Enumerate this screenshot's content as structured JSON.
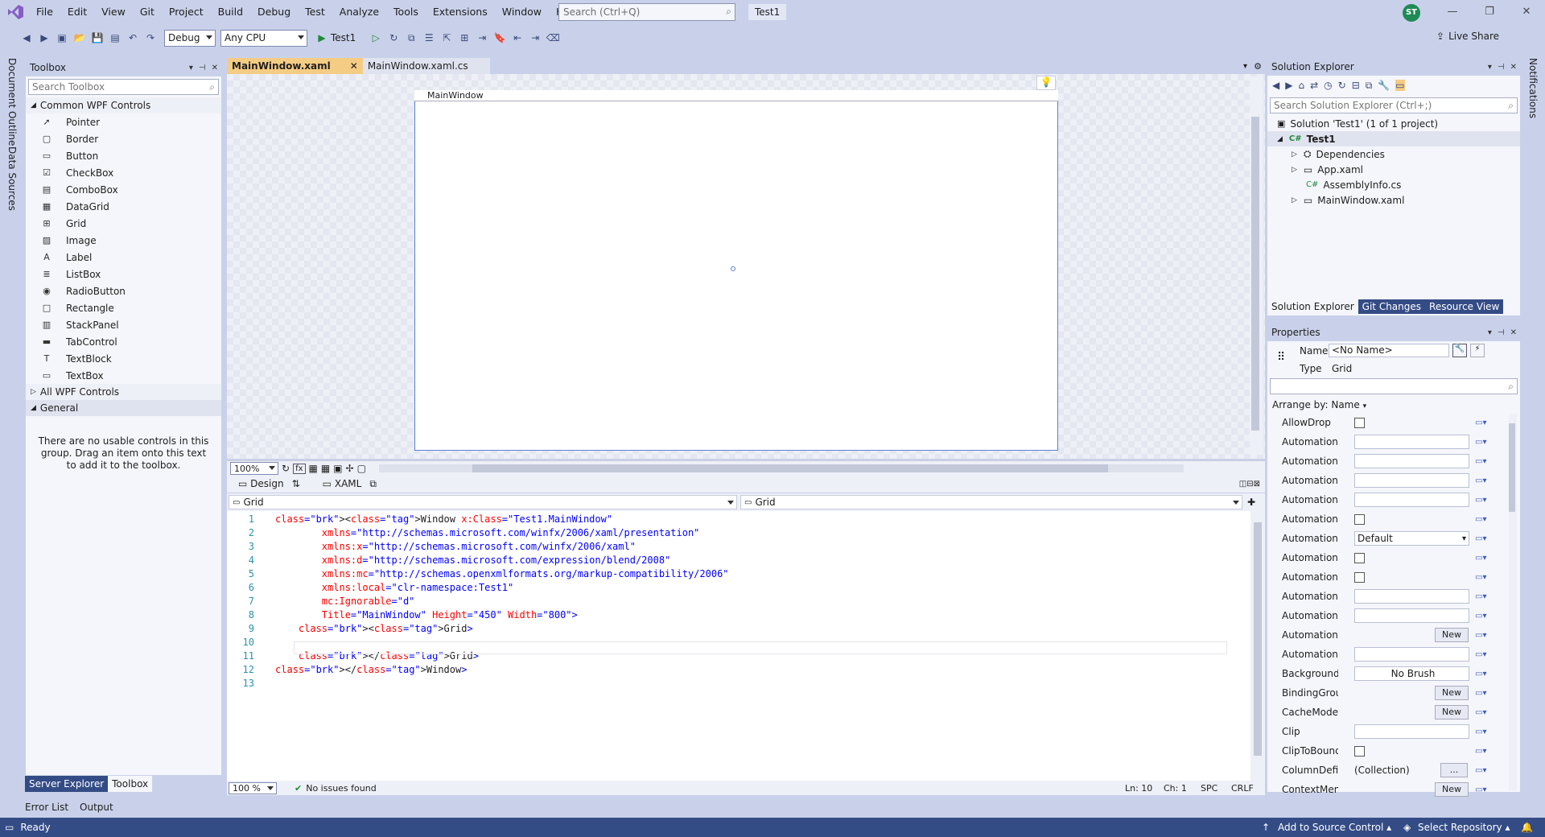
{
  "menu": [
    "File",
    "Edit",
    "View",
    "Git",
    "Project",
    "Build",
    "Debug",
    "Test",
    "Analyze",
    "Tools",
    "Extensions",
    "Window",
    "Help"
  ],
  "search": {
    "placeholder": "Search (Ctrl+Q)"
  },
  "solution_name": "Test1",
  "avatar_initials": "ST",
  "toolbar": {
    "config": "Debug",
    "platform": "Any CPU",
    "start": "Test1",
    "live_share": "Live Share"
  },
  "left_strip": [
    "Document Outline",
    "Data Sources"
  ],
  "right_strip": [
    "Notifications"
  ],
  "toolbox": {
    "title": "Toolbox",
    "search_placeholder": "Search Toolbox",
    "group_common": "Common WPF Controls",
    "items": [
      "Pointer",
      "Border",
      "Button",
      "CheckBox",
      "ComboBox",
      "DataGrid",
      "Grid",
      "Image",
      "Label",
      "ListBox",
      "RadioButton",
      "Rectangle",
      "StackPanel",
      "TabControl",
      "TextBlock",
      "TextBox"
    ],
    "group_all": "All WPF Controls",
    "group_general": "General",
    "empty_text": "There are no usable controls in this group. Drag an item onto this text to add it to the toolbox.",
    "tabs": [
      "Server Explorer",
      "Toolbox"
    ]
  },
  "doc_tabs": [
    "MainWindow.xaml",
    "MainWindow.xaml.cs"
  ],
  "designer": {
    "window_title": "MainWindow",
    "zoom": "100%",
    "design_tab": "Design",
    "xaml_tab": "XAML"
  },
  "xaml_nav": {
    "left": "Grid",
    "right": "Grid"
  },
  "code": [
    {
      "n": "1",
      "t": "<Window x:Class=\"Test1.MainWindow\""
    },
    {
      "n": "2",
      "t": "        xmlns=\"http://schemas.microsoft.com/winfx/2006/xaml/presentation\""
    },
    {
      "n": "3",
      "t": "        xmlns:x=\"http://schemas.microsoft.com/winfx/2006/xaml\""
    },
    {
      "n": "4",
      "t": "        xmlns:d=\"http://schemas.microsoft.com/expression/blend/2008\""
    },
    {
      "n": "5",
      "t": "        xmlns:mc=\"http://schemas.openxmlformats.org/markup-compatibility/2006\""
    },
    {
      "n": "6",
      "t": "        xmlns:local=\"clr-namespace:Test1\""
    },
    {
      "n": "7",
      "t": "        mc:Ignorable=\"d\""
    },
    {
      "n": "8",
      "t": "        Title=\"MainWindow\" Height=\"450\" Width=\"800\">"
    },
    {
      "n": "9",
      "t": "    <Grid>"
    },
    {
      "n": "10",
      "t": ""
    },
    {
      "n": "11",
      "t": "    </Grid>"
    },
    {
      "n": "12",
      "t": "</Window>"
    },
    {
      "n": "13",
      "t": ""
    }
  ],
  "code_status": {
    "zoom": "100 %",
    "issues": "No issues found",
    "ln": "Ln: 10",
    "ch": "Ch: 1",
    "spc": "SPC",
    "crlf": "CRLF"
  },
  "solution_explorer": {
    "title": "Solution Explorer",
    "search_placeholder": "Search Solution Explorer (Ctrl+;)",
    "tree": [
      "Solution 'Test1' (1 of 1 project)",
      "Test1",
      "Dependencies",
      "App.xaml",
      "AssemblyInfo.cs",
      "MainWindow.xaml"
    ],
    "tabs": [
      "Solution Explorer",
      "Git Changes",
      "Resource View"
    ]
  },
  "properties": {
    "title": "Properties",
    "name_label": "Name",
    "name_value": "<No Name>",
    "type_label": "Type",
    "type_value": "Grid",
    "arrange": "Arrange by: Name",
    "rows": [
      {
        "name": "AllowDrop",
        "kind": "check"
      },
      {
        "name": "AutomationPr...",
        "kind": "text"
      },
      {
        "name": "AutomationPr...",
        "kind": "text"
      },
      {
        "name": "AutomationPr...",
        "kind": "text"
      },
      {
        "name": "AutomationPr...",
        "kind": "text"
      },
      {
        "name": "AutomationPr...",
        "kind": "check"
      },
      {
        "name": "AutomationPr...",
        "kind": "combo",
        "value": "Default"
      },
      {
        "name": "AutomationPr...",
        "kind": "check"
      },
      {
        "name": "AutomationPr...",
        "kind": "check"
      },
      {
        "name": "AutomationPr...",
        "kind": "text"
      },
      {
        "name": "AutomationPr...",
        "kind": "text"
      },
      {
        "name": "AutomationPr...",
        "kind": "button",
        "value": "New"
      },
      {
        "name": "AutomationPr...",
        "kind": "text"
      },
      {
        "name": "Background",
        "kind": "center",
        "value": "No Brush"
      },
      {
        "name": "BindingGroup",
        "kind": "button",
        "value": "New"
      },
      {
        "name": "CacheMode",
        "kind": "button",
        "value": "New"
      },
      {
        "name": "Clip",
        "kind": "text"
      },
      {
        "name": "ClipToBounds",
        "kind": "check"
      },
      {
        "name": "ColumnDefini...",
        "kind": "coll",
        "value": "(Collection)",
        "btn": "..."
      },
      {
        "name": "ContextMenu",
        "kind": "button",
        "value": "New"
      }
    ]
  },
  "bottom_tabs": [
    "Error List",
    "Output"
  ],
  "status": {
    "ready": "Ready",
    "source": "Add to Source Control",
    "repo": "Select Repository"
  }
}
